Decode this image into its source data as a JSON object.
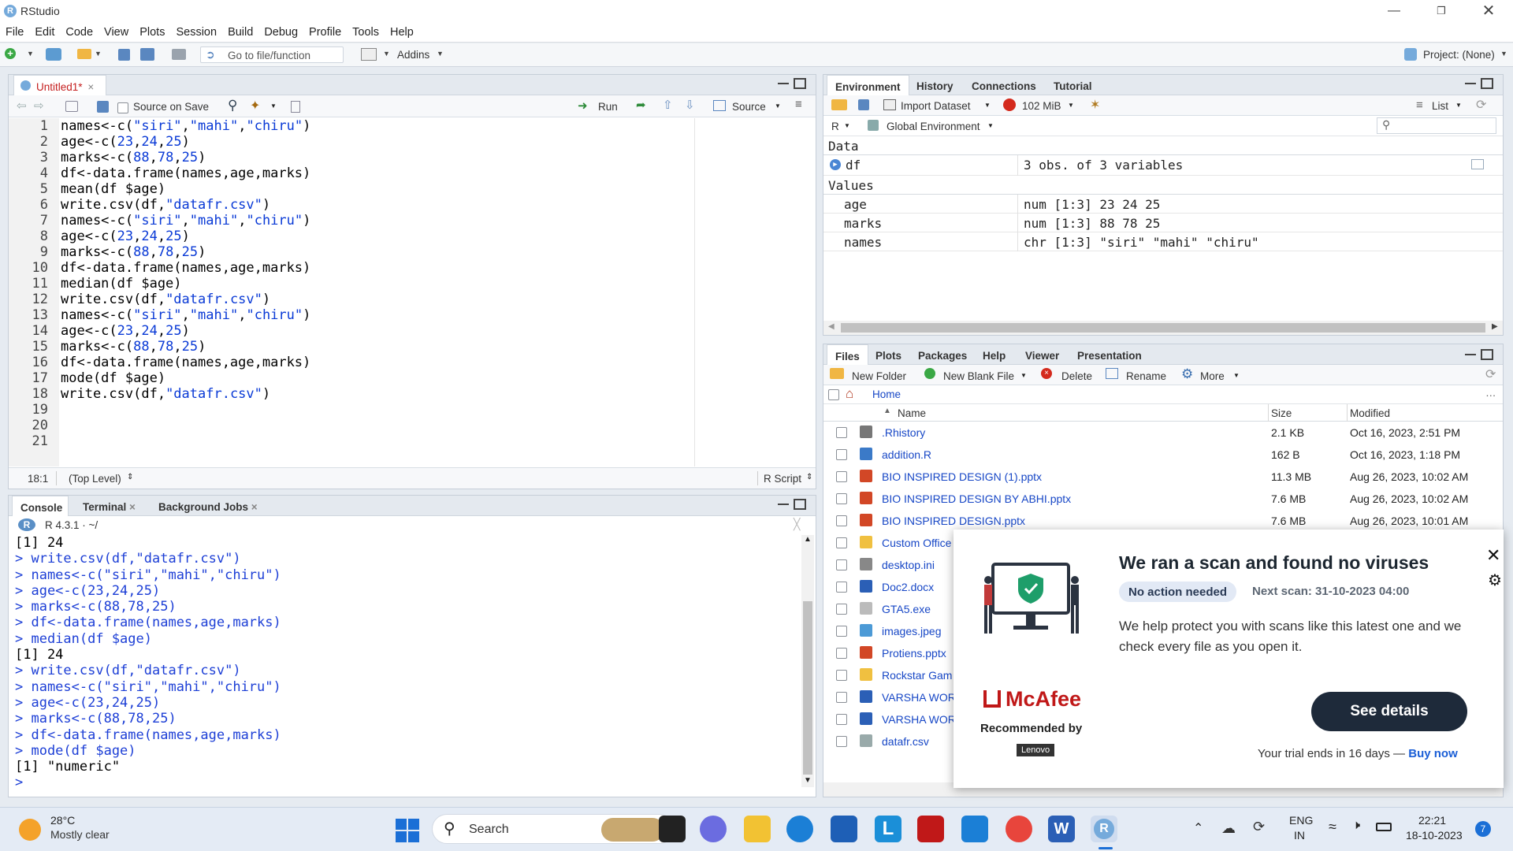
{
  "app": {
    "title": "RStudio"
  },
  "menu": [
    "File",
    "Edit",
    "Code",
    "View",
    "Plots",
    "Session",
    "Build",
    "Debug",
    "Profile",
    "Tools",
    "Help"
  ],
  "toolbar": {
    "goto_placeholder": "Go to file/function",
    "addins": "Addins",
    "project": "Project: (None)"
  },
  "editor": {
    "tab": "Untitled1*",
    "source_on_save": "Source on Save",
    "run": "Run",
    "source": "Source",
    "lines": [
      "names<-c(\"siri\",\"mahi\",\"chiru\")",
      "age<-c(23,24,25)",
      "marks<-c(88,78,25)",
      "df<-data.frame(names,age,marks)",
      "mean(df $age)",
      "write.csv(df,\"datafr.csv\")",
      "names<-c(\"siri\",\"mahi\",\"chiru\")",
      "age<-c(23,24,25)",
      "marks<-c(88,78,25)",
      "df<-data.frame(names,age,marks)",
      "median(df $age)",
      "write.csv(df,\"datafr.csv\")",
      "names<-c(\"siri\",\"mahi\",\"chiru\")",
      "age<-c(23,24,25)",
      "marks<-c(88,78,25)",
      "df<-data.frame(names,age,marks)",
      "mode(df $age)",
      "write.csv(df,\"datafr.csv\")",
      "",
      "",
      ""
    ],
    "status_pos": "18:1",
    "status_scope": "(Top Level)",
    "status_type": "R Script"
  },
  "console": {
    "tabs": [
      "Console",
      "Terminal",
      "Background Jobs"
    ],
    "version": "R 4.3.1 · ~/",
    "lines": [
      {
        "t": "out",
        "s": "[1] 24"
      },
      {
        "t": "cmd",
        "s": "> write.csv(df,\"datafr.csv\")"
      },
      {
        "t": "cmd",
        "s": "> names<-c(\"siri\",\"mahi\",\"chiru\")"
      },
      {
        "t": "cmd",
        "s": "> age<-c(23,24,25)"
      },
      {
        "t": "cmd",
        "s": "> marks<-c(88,78,25)"
      },
      {
        "t": "cmd",
        "s": "> df<-data.frame(names,age,marks)"
      },
      {
        "t": "cmd",
        "s": "> median(df $age)"
      },
      {
        "t": "out",
        "s": "[1] 24"
      },
      {
        "t": "cmd",
        "s": "> write.csv(df,\"datafr.csv\")"
      },
      {
        "t": "cmd",
        "s": "> names<-c(\"siri\",\"mahi\",\"chiru\")"
      },
      {
        "t": "cmd",
        "s": "> age<-c(23,24,25)"
      },
      {
        "t": "cmd",
        "s": "> marks<-c(88,78,25)"
      },
      {
        "t": "cmd",
        "s": "> df<-data.frame(names,age,marks)"
      },
      {
        "t": "cmd",
        "s": "> mode(df $age)"
      },
      {
        "t": "out",
        "s": "[1] \"numeric\""
      },
      {
        "t": "cmd",
        "s": "> "
      }
    ]
  },
  "env": {
    "tabs": [
      "Environment",
      "History",
      "Connections",
      "Tutorial"
    ],
    "import": "Import Dataset",
    "memory": "102 MiB",
    "list": "List",
    "lang": "R",
    "scope": "Global Environment",
    "data_header": "Data",
    "values_header": "Values",
    "data": [
      {
        "name": "df",
        "value": "3 obs. of 3 variables"
      }
    ],
    "values": [
      {
        "name": "age",
        "value": "num [1:3] 23 24 25"
      },
      {
        "name": "marks",
        "value": "num [1:3] 88 78 25"
      },
      {
        "name": "names",
        "value": "chr [1:3] \"siri\" \"mahi\" \"chiru\""
      }
    ]
  },
  "files": {
    "tabs": [
      "Files",
      "Plots",
      "Packages",
      "Help",
      "Viewer",
      "Presentation"
    ],
    "new_folder": "New Folder",
    "new_blank": "New Blank File",
    "delete": "Delete",
    "rename": "Rename",
    "more": "More",
    "home": "Home",
    "headers": {
      "name": "Name",
      "size": "Size",
      "modified": "Modified"
    },
    "rows": [
      {
        "name": ".Rhistory",
        "size": "2.1 KB",
        "modified": "Oct 16, 2023, 2:51 PM",
        "icon": "history-icon"
      },
      {
        "name": "addition.R",
        "size": "162 B",
        "modified": "Oct 16, 2023, 1:18 PM",
        "icon": "r-file-icon"
      },
      {
        "name": "BIO INSPIRED DESIGN (1).pptx",
        "size": "11.3 MB",
        "modified": "Aug 26, 2023, 10:02 AM",
        "icon": "pptx-icon"
      },
      {
        "name": "BIO INSPIRED DESIGN BY ABHI.pptx",
        "size": "7.6 MB",
        "modified": "Aug 26, 2023, 10:02 AM",
        "icon": "pptx-icon"
      },
      {
        "name": "BIO INSPIRED DESIGN.pptx",
        "size": "7.6 MB",
        "modified": "Aug 26, 2023, 10:01 AM",
        "icon": "pptx-icon"
      },
      {
        "name": "Custom Office",
        "size": "",
        "modified": "",
        "icon": "folder-icon"
      },
      {
        "name": "desktop.ini",
        "size": "",
        "modified": "",
        "icon": "settings-file-icon"
      },
      {
        "name": "Doc2.docx",
        "size": "",
        "modified": "",
        "icon": "word-icon"
      },
      {
        "name": "GTA5.exe",
        "size": "",
        "modified": "",
        "icon": "file-icon"
      },
      {
        "name": "images.jpeg",
        "size": "",
        "modified": "",
        "icon": "image-icon"
      },
      {
        "name": "Protiens.pptx",
        "size": "",
        "modified": "",
        "icon": "pptx-icon"
      },
      {
        "name": "Rockstar Gam",
        "size": "",
        "modified": "",
        "icon": "folder-icon"
      },
      {
        "name": "VARSHA WOR",
        "size": "",
        "modified": "",
        "icon": "word-icon"
      },
      {
        "name": "VARSHA WOR",
        "size": "",
        "modified": "",
        "icon": "word-icon"
      },
      {
        "name": "datafr.csv",
        "size": "",
        "modified": "",
        "icon": "csv-icon"
      }
    ]
  },
  "popup": {
    "title": "We ran a scan and found no viruses",
    "badge": "No action needed",
    "next_scan": "Next scan: 31-10-2023 04:00",
    "body": "We help protect you with scans like this latest one and we check every file as you open it.",
    "brand": "McAfee",
    "recommended": "Recommended by",
    "partner": "Lenovo",
    "cta": "See details",
    "trial": "Your trial ends in 16 days —",
    "buy": "Buy now"
  },
  "taskbar": {
    "temp": "28°C",
    "weather": "Mostly clear",
    "search": "Search",
    "lang1": "ENG",
    "lang2": "IN",
    "time": "22:21",
    "date": "18-10-2023",
    "notif": "7"
  },
  "colors": {
    "rstudio_blue": "#75aadb",
    "link_blue": "#1747c6",
    "mcafee_red": "#c01818",
    "cta_dark": "#1e2a3a"
  }
}
